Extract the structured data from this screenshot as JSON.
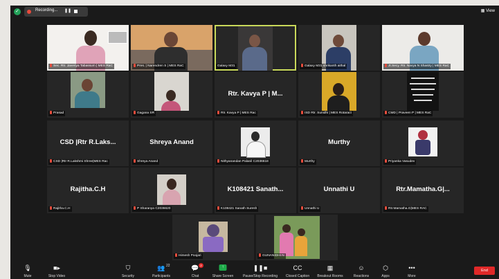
{
  "recording": {
    "label": "Recording...",
    "pause": "❚❚"
  },
  "view_label": "View",
  "participants": [
    "Sec. Rtr. Javeriya Tabassum | MES RaC",
    "Pres. | Narendren S | MES RaC",
    "Galaxy M31",
    "Galaxy M31 shrikanth aithal",
    "Jt.Secy. Rtr. Navya N Shastry | MES RaC",
    "Prasad",
    "Gagana SR",
    "Rtr. Kavya P | MES Rac",
    "ISD Rtr. Sunidhi | MES Rotaract",
    "CMD | Praveen P | MES RaC",
    "CSD |Rtr R.Lakshmi Shree|MES Rac",
    "Shreya Anand",
    "Nithyanandan Palanil C2036618",
    "Murthy",
    "Priyanka Vasudev",
    "Rajitha.C.H",
    "P Sharanya C2036620",
    "K108421 Sanath Suresh",
    "Unnathi U",
    "Rtr.Mamatha.G|MES RAC",
    "Himesh Poojari",
    "GUNANIDHI N"
  ],
  "big_names": {
    "kavya": "Rtr. Kavya P | M...",
    "lakshmi": "CSD |Rtr R.Laks...",
    "shreya": "Shreya Anand",
    "murthy": "Murthy",
    "rajitha": "Rajitha.C.H",
    "sanath": "K108421 Sanath...",
    "unnathi": "Unnathi U",
    "mamatha": "Rtr.Mamatha.G|..."
  },
  "toolbar": {
    "mute": "Mute",
    "stop_video": "Stop Video",
    "security": "Security",
    "participants": "Participants",
    "participants_count": "22",
    "chat": "Chat",
    "chat_badge": "2",
    "share_screen": "Share Screen",
    "pause_recording": "Pause/Stop Recording",
    "closed_caption": "Closed Caption",
    "breakout_rooms": "Breakout Rooms",
    "reactions": "Reactions",
    "apps": "Apps",
    "more": "More",
    "end": "End"
  },
  "icons": {
    "security": "shield-icon",
    "mic": "microphone-icon",
    "video": "camera-icon",
    "participants": "people-icon",
    "chat": "chat-icon",
    "share": "share-arrow-icon",
    "record": "pause-stop-icon",
    "cc": "cc-icon",
    "breakout": "grid-icon",
    "reactions": "smiley-icon",
    "apps": "apps-icon",
    "more": "ellipsis-icon"
  },
  "colors": {
    "end_button": "#e02828",
    "active_speaker_border": "#c9d95a",
    "share_button": "#1faa4a",
    "muted_mic": "#e64c3c"
  }
}
